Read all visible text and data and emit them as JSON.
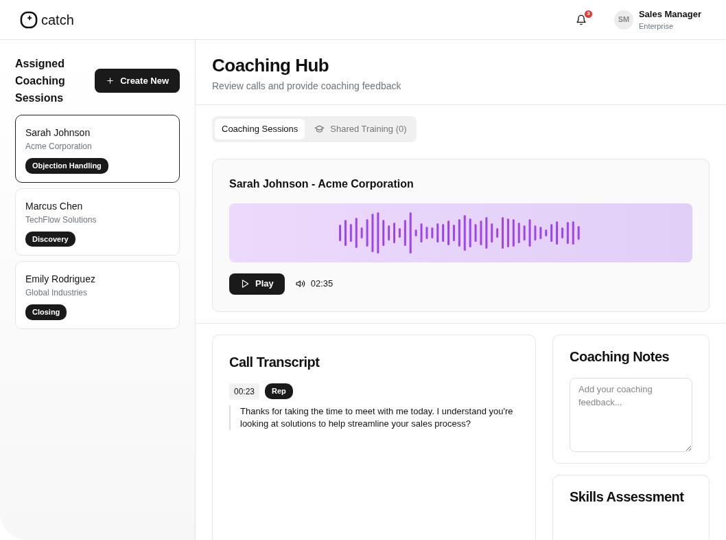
{
  "brand": {
    "name": "catch"
  },
  "header": {
    "notification_count": "3",
    "user": {
      "initials": "SM",
      "name": "Sales Manager",
      "plan": "Enterprise"
    }
  },
  "sidebar": {
    "title": "Assigned Coaching Sessions",
    "create_button": "Create New",
    "sessions": [
      {
        "name": "Sarah Johnson",
        "company": "Acme Corporation",
        "tag": "Objection Handling",
        "selected": true
      },
      {
        "name": "Marcus Chen",
        "company": "TechFlow Solutions",
        "tag": "Discovery",
        "selected": false
      },
      {
        "name": "Emily Rodriguez",
        "company": "Global Industries",
        "tag": "Closing",
        "selected": false
      }
    ]
  },
  "page": {
    "title": "Coaching Hub",
    "subtitle": "Review calls and provide coaching feedback"
  },
  "tabs": [
    {
      "label": "Coaching Sessions",
      "selected": true,
      "kind": "sessions"
    },
    {
      "label": "Shared Training (0)",
      "selected": false,
      "kind": "training"
    }
  ],
  "player": {
    "title": "Sarah Johnson - Acme Corporation",
    "play_button": "Play",
    "duration": "02:35"
  },
  "transcript": {
    "title": "Call Transcript",
    "entries": [
      {
        "time": "00:23",
        "speaker": "Rep",
        "text": "Thanks for taking the time to meet with me today. I understand you're looking at solutions to help streamline your sales process?"
      }
    ]
  },
  "notes": {
    "title": "Coaching Notes",
    "placeholder": "Add your coaching feedback..."
  },
  "skills": {
    "title": "Skills Assessment"
  }
}
